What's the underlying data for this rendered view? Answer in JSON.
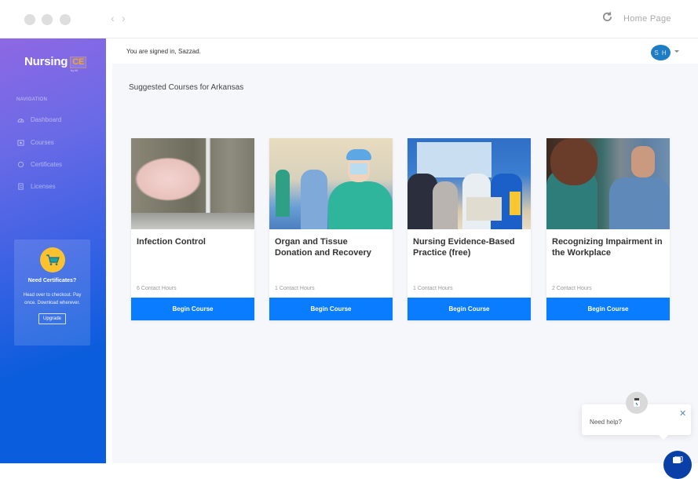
{
  "browser": {
    "home_label": "Home Page",
    "icons": [
      "back-arrow",
      "forward-arrow",
      "refresh-icon"
    ]
  },
  "sidebar": {
    "logo_main": "Nursing",
    "logo_badge": "CE",
    "logo_by": "by lili",
    "nav_title": "NAVIGATION",
    "items": [
      {
        "label": "Dashboard",
        "icon": "dashboard-icon"
      },
      {
        "label": "Courses",
        "icon": "courses-icon"
      },
      {
        "label": "Certificates",
        "icon": "certificates-icon"
      },
      {
        "label": "Licenses",
        "icon": "licenses-icon"
      }
    ],
    "promo": {
      "title": "Need Certificates?",
      "text": "Head over to checkout. Pay once. Download wherever.",
      "button": "Upgrade",
      "icon": "cart-icon"
    },
    "colors": {
      "gradient_top": "#8e68e4",
      "gradient_bottom": "#0a5ddc"
    }
  },
  "header": {
    "signed_in_text": "You are signed in, Sazzad.",
    "avatar_initials": "S H"
  },
  "main": {
    "section_title": "Suggested Courses for Arkansas",
    "courses": [
      {
        "title": "Infection Control",
        "hours": "6 Contact Hours",
        "button": "Begin Course",
        "image": "handwashing-photo"
      },
      {
        "title": "Organ and Tissue Donation and Recovery",
        "hours": "1 Contact Hours",
        "button": "Begin Course",
        "image": "surgical-team-photo"
      },
      {
        "title": "Nursing Evidence-Based Practice (free)",
        "hours": "1 Contact Hours",
        "button": "Begin Course",
        "image": "team-meeting-photo"
      },
      {
        "title": "Recognizing Impairment in the Workplace",
        "hours": "2 Contact Hours",
        "button": "Begin Course",
        "image": "stressed-nurse-photo"
      }
    ],
    "accent_color": "#0a7cff"
  },
  "help_widget": {
    "text": "Need help?",
    "close": "✕"
  }
}
